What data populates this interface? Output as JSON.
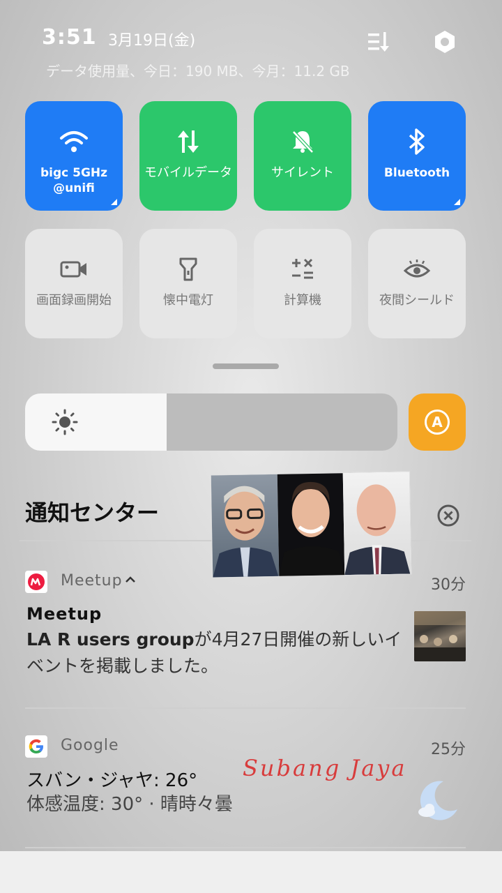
{
  "status": {
    "time": "3:51",
    "date": "3月19日(金)",
    "data_usage": "データ使用量、今日：190 MB、今月：11.2 GB"
  },
  "tiles": [
    {
      "label": "bigc 5GHz\n@unifi",
      "icon": "wifi-icon",
      "state": "on",
      "color": "#1f7cf5"
    },
    {
      "label": "モバイルデータ",
      "icon": "mobile-data-icon",
      "state": "on",
      "color": "#2cc76b"
    },
    {
      "label": "サイレント",
      "icon": "bell-off-icon",
      "state": "on",
      "color": "#2cc76b"
    },
    {
      "label": "Bluetooth",
      "icon": "bluetooth-icon",
      "state": "on",
      "color": "#1f7cf5"
    },
    {
      "label": "画面録画開始",
      "icon": "video-camera-icon",
      "state": "off"
    },
    {
      "label": "懐中電灯",
      "icon": "flashlight-icon",
      "state": "off"
    },
    {
      "label": "計算機",
      "icon": "calculator-icon",
      "state": "off"
    },
    {
      "label": "夜間シールド",
      "icon": "eye-icon",
      "state": "off"
    }
  ],
  "brightness": {
    "level": 0.38,
    "auto_label": "A"
  },
  "notification_center": {
    "title": "通知センター"
  },
  "notifications": [
    {
      "app": "Meetup",
      "time": "30分",
      "title": "Meetup",
      "body_bold": "LA R users group",
      "body": "が4月27日開催の新しいイベントを掲載しました。"
    },
    {
      "app": "Google",
      "time": "25分",
      "title": "スバン・ジャヤ: 26°",
      "body": "体感温度: 30° · 晴時々曇"
    }
  ],
  "overlay_text": "Subang Jaya",
  "colors": {
    "accent_blue": "#1f7cf5",
    "accent_green": "#2cc76b",
    "auto_orange": "#f5a623"
  }
}
